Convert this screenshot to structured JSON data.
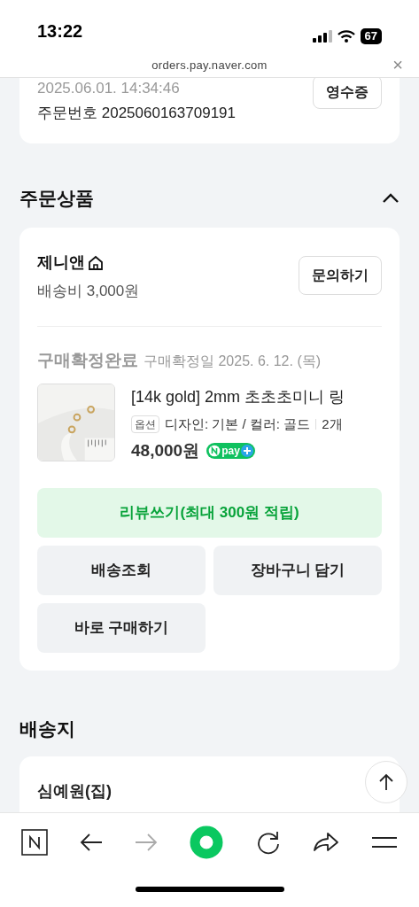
{
  "status_bar": {
    "time": "13:22",
    "battery": "67"
  },
  "url_bar": {
    "url": "orders.pay.naver.com",
    "close": "×"
  },
  "order_card": {
    "date": "2025.06.01. 14:34:46",
    "order_number": "주문번호 2025060163709191",
    "receipt_button": "영수증"
  },
  "products_section": {
    "title": "주문상품",
    "expanded": true,
    "seller": {
      "name": "제니앤",
      "shipping": "배송비 3,000원",
      "inquiry_button": "문의하기"
    },
    "status": "구매확정완료",
    "confirm_date": "구매확정일 2025. 6. 12. (목)",
    "product": {
      "title": "[14k gold] 2mm 초초초미니 링",
      "option_badge": "옵션",
      "option": "디자인: 기본 / 컬러: 골드",
      "quantity": "2개",
      "price": "48,000원",
      "npay_badge": "pay"
    },
    "review_button": "리뷰쓰기(최대 300원 적립)",
    "buttons": [
      "배송조회",
      "장바구니 담기",
      "바로 구매하기"
    ]
  },
  "shipping_section": {
    "title": "배송지",
    "recipient": "심예원(집)"
  },
  "toolbar": [
    {
      "kind": "home",
      "disabled": false
    },
    {
      "kind": "back",
      "disabled": false
    },
    {
      "kind": "forward",
      "disabled": true
    },
    {
      "kind": "green",
      "disabled": false
    },
    {
      "kind": "reload",
      "disabled": false
    },
    {
      "kind": "share",
      "disabled": false
    },
    {
      "kind": "menu",
      "disabled": false
    }
  ]
}
